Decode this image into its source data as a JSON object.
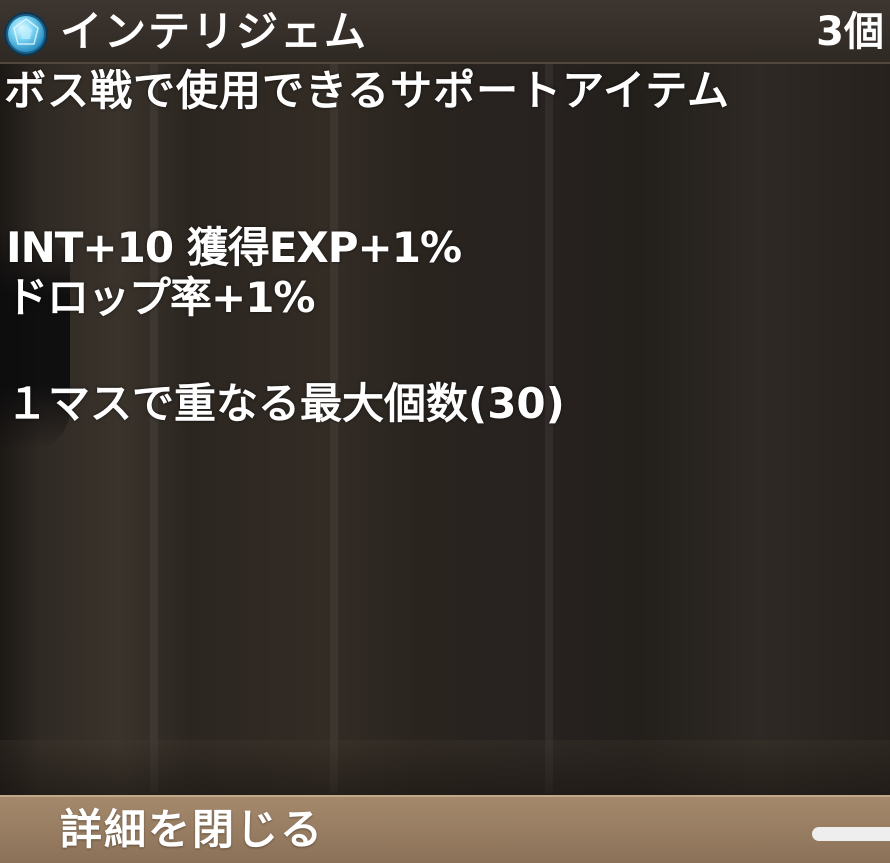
{
  "item": {
    "icon": "blue-gem-icon",
    "name": "インテリジェム",
    "count": "3個"
  },
  "description": "ボス戦で使用できるサポートアイテム",
  "stats": {
    "line1": "INT+10  獲得EXP+1%",
    "line2": "ドロップ率+1%"
  },
  "stack_info": "１マスで重なる最大個数(30)",
  "close_button": {
    "label": "詳細を閉じる"
  },
  "colors": {
    "title_bar": "#2f2924",
    "close_bar": "#9a7f64",
    "text": "#ffffff",
    "gem": "#5ec8f0"
  }
}
